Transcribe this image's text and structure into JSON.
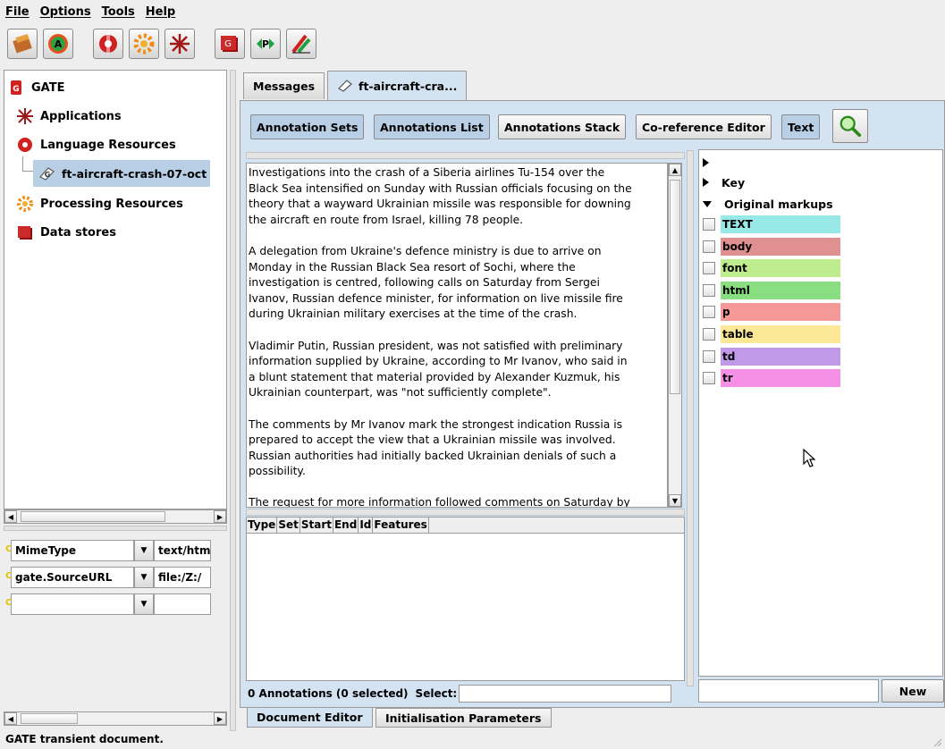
{
  "menu": {
    "file": "File",
    "options": "Options",
    "tools": "Tools",
    "help": "Help"
  },
  "toolbar": {
    "icons": [
      "load-application-icon",
      "annie-icon",
      "new-language-resource-icon",
      "new-processing-resource-icon",
      "new-application-icon",
      "data-store-icon",
      "plugin-manager-icon",
      "annotation-diff-icon"
    ]
  },
  "tree": {
    "root": "GATE",
    "applications": "Applications",
    "language_resources": "Language Resources",
    "document": "ft-aircraft-crash-07-oct",
    "processing_resources": "Processing Resources",
    "data_stores": "Data stores"
  },
  "features": {
    "rows": [
      {
        "name": "MimeType",
        "value": "text/htm"
      },
      {
        "name": "gate.SourceURL",
        "value": "file:/Z:/"
      },
      {
        "name": "",
        "value": ""
      }
    ]
  },
  "status": "GATE transient document.",
  "tabs": {
    "messages": "Messages",
    "document": "ft-aircraft-cra..."
  },
  "view_buttons": {
    "annotation_sets": "Annotation Sets",
    "annotations_list": "Annotations List",
    "annotations_stack": "Annotations Stack",
    "coreference_editor": "Co-reference Editor",
    "text": "Text"
  },
  "document_text": "Investigations into the crash of a Siberia airlines Tu-154 over the\nBlack Sea intensified on Sunday with Russian officials focusing on the\ntheory that a wayward Ukrainian missile was responsible for downing\nthe aircraft en route from Israel, killing 78 people.\n\nA delegation from Ukraine's defence ministry is due to arrive on\nMonday in the Russian Black Sea resort of Sochi, where the\ninvestigation is centred, following calls on Saturday from Sergei\nIvanov, Russian defence minister, for information on live missile fire\nduring Ukrainian military exercises at the time of the crash.\n\nVladimir Putin, Russian president, was not satisfied with preliminary\ninformation supplied by Ukraine, according to Mr Ivanov, who said in\na blunt statement that material provided by Alexander Kuzmuk, his\nUkrainian counterpart, was \"not sufficiently complete\".\n\nThe comments by Mr Ivanov mark the strongest indication Russia is\nprepared to accept the view that a Ukrainian missile was involved.\nRussian authorities had initially backed Ukrainian denials of such a\npossibility.\n\nThe request for more information followed comments on Saturday by",
  "annotation_table": {
    "columns": [
      "Type",
      "Set",
      "Start",
      "End",
      "Id",
      "Features"
    ],
    "summary": "0 Annotations (0 selected)",
    "select_label": "Select:"
  },
  "annotation_sets": {
    "default_set": "",
    "key": "Key",
    "original_markups": "Original markups",
    "types": [
      {
        "name": "TEXT",
        "color": "#99e8e8"
      },
      {
        "name": "body",
        "color": "#e09090"
      },
      {
        "name": "font",
        "color": "#c0ec90"
      },
      {
        "name": "html",
        "color": "#8ade82"
      },
      {
        "name": "p",
        "color": "#f59898"
      },
      {
        "name": "table",
        "color": "#fce896"
      },
      {
        "name": "td",
        "color": "#c09ae8"
      },
      {
        "name": "tr",
        "color": "#f590e6"
      }
    ],
    "new_button": "New"
  },
  "bottom_tabs": {
    "document_editor": "Document Editor",
    "init_params": "Initialisation Parameters"
  }
}
